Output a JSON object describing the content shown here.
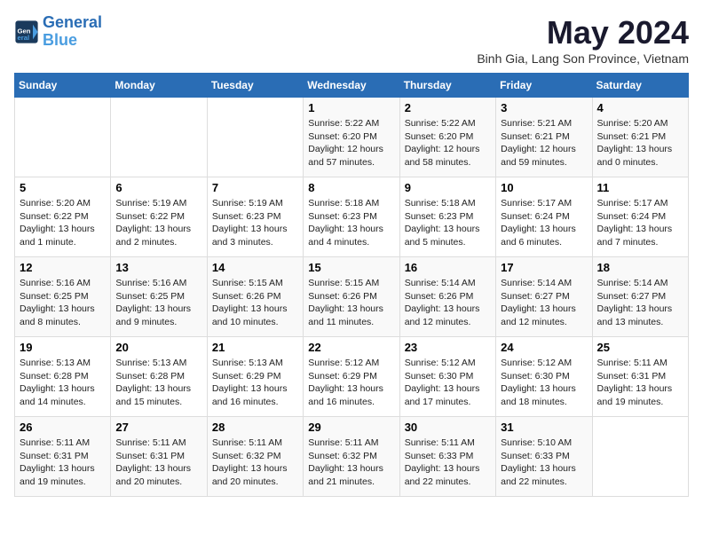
{
  "logo": {
    "line1": "General",
    "line2": "Blue"
  },
  "title": "May 2024",
  "subtitle": "Binh Gia, Lang Son Province, Vietnam",
  "days_of_week": [
    "Sunday",
    "Monday",
    "Tuesday",
    "Wednesday",
    "Thursday",
    "Friday",
    "Saturday"
  ],
  "weeks": [
    [
      {
        "day": "",
        "info": ""
      },
      {
        "day": "",
        "info": ""
      },
      {
        "day": "",
        "info": ""
      },
      {
        "day": "1",
        "info": "Sunrise: 5:22 AM\nSunset: 6:20 PM\nDaylight: 12 hours and 57 minutes."
      },
      {
        "day": "2",
        "info": "Sunrise: 5:22 AM\nSunset: 6:20 PM\nDaylight: 12 hours and 58 minutes."
      },
      {
        "day": "3",
        "info": "Sunrise: 5:21 AM\nSunset: 6:21 PM\nDaylight: 12 hours and 59 minutes."
      },
      {
        "day": "4",
        "info": "Sunrise: 5:20 AM\nSunset: 6:21 PM\nDaylight: 13 hours and 0 minutes."
      }
    ],
    [
      {
        "day": "5",
        "info": "Sunrise: 5:20 AM\nSunset: 6:22 PM\nDaylight: 13 hours and 1 minute."
      },
      {
        "day": "6",
        "info": "Sunrise: 5:19 AM\nSunset: 6:22 PM\nDaylight: 13 hours and 2 minutes."
      },
      {
        "day": "7",
        "info": "Sunrise: 5:19 AM\nSunset: 6:23 PM\nDaylight: 13 hours and 3 minutes."
      },
      {
        "day": "8",
        "info": "Sunrise: 5:18 AM\nSunset: 6:23 PM\nDaylight: 13 hours and 4 minutes."
      },
      {
        "day": "9",
        "info": "Sunrise: 5:18 AM\nSunset: 6:23 PM\nDaylight: 13 hours and 5 minutes."
      },
      {
        "day": "10",
        "info": "Sunrise: 5:17 AM\nSunset: 6:24 PM\nDaylight: 13 hours and 6 minutes."
      },
      {
        "day": "11",
        "info": "Sunrise: 5:17 AM\nSunset: 6:24 PM\nDaylight: 13 hours and 7 minutes."
      }
    ],
    [
      {
        "day": "12",
        "info": "Sunrise: 5:16 AM\nSunset: 6:25 PM\nDaylight: 13 hours and 8 minutes."
      },
      {
        "day": "13",
        "info": "Sunrise: 5:16 AM\nSunset: 6:25 PM\nDaylight: 13 hours and 9 minutes."
      },
      {
        "day": "14",
        "info": "Sunrise: 5:15 AM\nSunset: 6:26 PM\nDaylight: 13 hours and 10 minutes."
      },
      {
        "day": "15",
        "info": "Sunrise: 5:15 AM\nSunset: 6:26 PM\nDaylight: 13 hours and 11 minutes."
      },
      {
        "day": "16",
        "info": "Sunrise: 5:14 AM\nSunset: 6:26 PM\nDaylight: 13 hours and 12 minutes."
      },
      {
        "day": "17",
        "info": "Sunrise: 5:14 AM\nSunset: 6:27 PM\nDaylight: 13 hours and 12 minutes."
      },
      {
        "day": "18",
        "info": "Sunrise: 5:14 AM\nSunset: 6:27 PM\nDaylight: 13 hours and 13 minutes."
      }
    ],
    [
      {
        "day": "19",
        "info": "Sunrise: 5:13 AM\nSunset: 6:28 PM\nDaylight: 13 hours and 14 minutes."
      },
      {
        "day": "20",
        "info": "Sunrise: 5:13 AM\nSunset: 6:28 PM\nDaylight: 13 hours and 15 minutes."
      },
      {
        "day": "21",
        "info": "Sunrise: 5:13 AM\nSunset: 6:29 PM\nDaylight: 13 hours and 16 minutes."
      },
      {
        "day": "22",
        "info": "Sunrise: 5:12 AM\nSunset: 6:29 PM\nDaylight: 13 hours and 16 minutes."
      },
      {
        "day": "23",
        "info": "Sunrise: 5:12 AM\nSunset: 6:30 PM\nDaylight: 13 hours and 17 minutes."
      },
      {
        "day": "24",
        "info": "Sunrise: 5:12 AM\nSunset: 6:30 PM\nDaylight: 13 hours and 18 minutes."
      },
      {
        "day": "25",
        "info": "Sunrise: 5:11 AM\nSunset: 6:31 PM\nDaylight: 13 hours and 19 minutes."
      }
    ],
    [
      {
        "day": "26",
        "info": "Sunrise: 5:11 AM\nSunset: 6:31 PM\nDaylight: 13 hours and 19 minutes."
      },
      {
        "day": "27",
        "info": "Sunrise: 5:11 AM\nSunset: 6:31 PM\nDaylight: 13 hours and 20 minutes."
      },
      {
        "day": "28",
        "info": "Sunrise: 5:11 AM\nSunset: 6:32 PM\nDaylight: 13 hours and 20 minutes."
      },
      {
        "day": "29",
        "info": "Sunrise: 5:11 AM\nSunset: 6:32 PM\nDaylight: 13 hours and 21 minutes."
      },
      {
        "day": "30",
        "info": "Sunrise: 5:11 AM\nSunset: 6:33 PM\nDaylight: 13 hours and 22 minutes."
      },
      {
        "day": "31",
        "info": "Sunrise: 5:10 AM\nSunset: 6:33 PM\nDaylight: 13 hours and 22 minutes."
      },
      {
        "day": "",
        "info": ""
      }
    ]
  ]
}
